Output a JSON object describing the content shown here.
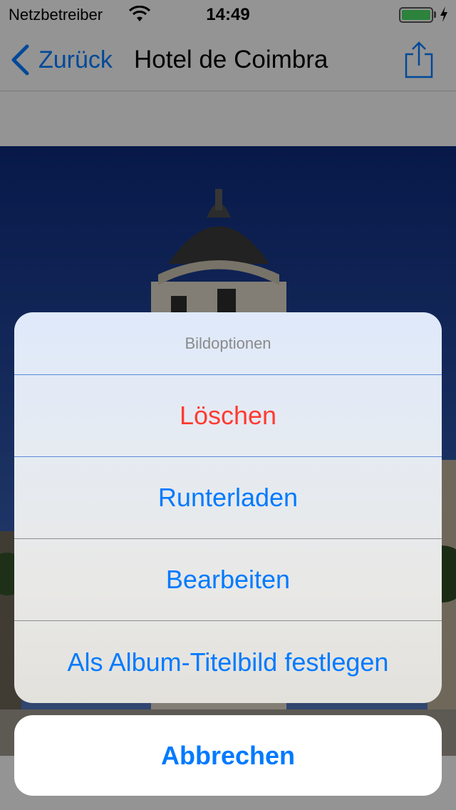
{
  "status_bar": {
    "carrier": "Netzbetreiber",
    "time": "14:49",
    "battery_level": 1.0,
    "battery_color": "#4cd964"
  },
  "nav": {
    "back_label": "Zurück",
    "title": "Hotel de Coimbra",
    "share_icon": "share-icon"
  },
  "action_sheet": {
    "title": "Bildoptionen",
    "actions": [
      {
        "label": "Löschen",
        "style": "destructive",
        "color": "#ff3b30"
      },
      {
        "label": "Runterladen",
        "style": "default",
        "color": "#007aff"
      },
      {
        "label": "Bearbeiten",
        "style": "default",
        "color": "#007aff"
      },
      {
        "label": "Als Album-Titelbild festlegen",
        "style": "default",
        "color": "#007aff"
      }
    ],
    "cancel_label": "Abbrechen"
  },
  "colors": {
    "accent": "#007aff",
    "destructive": "#ff3b30"
  }
}
